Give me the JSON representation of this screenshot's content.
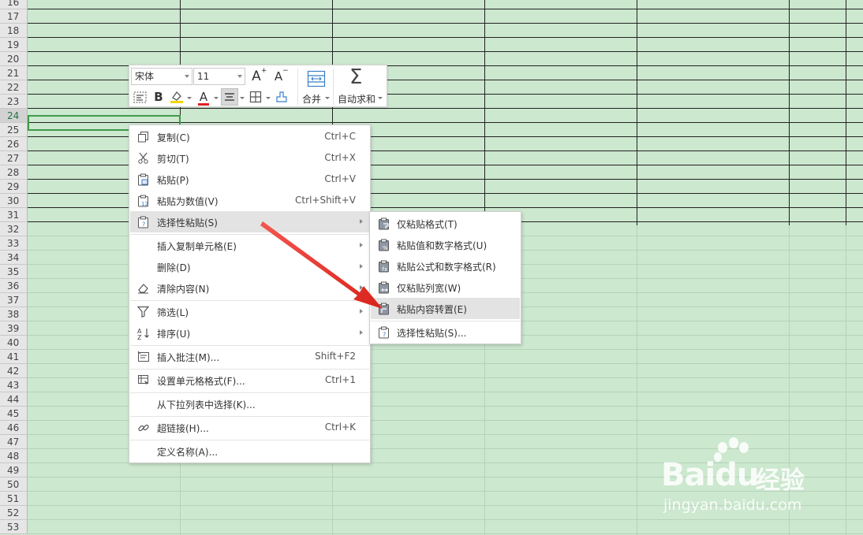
{
  "sheet": {
    "row_numbers": [
      "16",
      "17",
      "18",
      "19",
      "20",
      "21",
      "22",
      "23",
      "24",
      "25",
      "26",
      "27",
      "28",
      "29",
      "30",
      "31",
      "32",
      "33",
      "34",
      "35",
      "36",
      "37",
      "38",
      "39",
      "40",
      "41",
      "42",
      "43",
      "44",
      "45",
      "46",
      "47",
      "48",
      "49",
      "50",
      "51",
      "52",
      "53"
    ],
    "active_row": "24",
    "bordered_rows": [
      "16",
      "17",
      "18",
      "19",
      "20",
      "21",
      "22",
      "23",
      "24",
      "25",
      "26",
      "27",
      "28",
      "29",
      "30",
      "31"
    ]
  },
  "mini_toolbar": {
    "font_name": "宋体",
    "font_size": "11",
    "increase_font_icon": "font-increase-icon",
    "decrease_font_icon": "font-decrease-icon",
    "merge_label": "合并",
    "autosum_label": "自动求和",
    "bold_glyph": "B",
    "font_color_glyph": "A",
    "grow_glyph": "A",
    "shrink_glyph": "A"
  },
  "context_menu": {
    "items": [
      {
        "label": "复制(C)",
        "shortcut": "Ctrl+C",
        "icon": "copy-icon"
      },
      {
        "label": "剪切(T)",
        "shortcut": "Ctrl+X",
        "icon": "cut-icon"
      },
      {
        "label": "粘贴(P)",
        "shortcut": "Ctrl+V",
        "icon": "paste-icon"
      },
      {
        "label": "粘贴为数值(V)",
        "shortcut": "Ctrl+Shift+V",
        "icon": "paste-values-icon"
      },
      {
        "label": "选择性粘贴(S)",
        "shortcut": "",
        "icon": "paste-special-icon"
      },
      {
        "label": "插入复制单元格(E)",
        "shortcut": "",
        "icon": ""
      },
      {
        "label": "删除(D)",
        "shortcut": "",
        "icon": ""
      },
      {
        "label": "清除内容(N)",
        "shortcut": "",
        "icon": "eraser-icon"
      },
      {
        "label": "筛选(L)",
        "shortcut": "",
        "icon": "filter-icon"
      },
      {
        "label": "排序(U)",
        "shortcut": "",
        "icon": "sort-icon"
      },
      {
        "label": "插入批注(M)...",
        "shortcut": "Shift+F2",
        "icon": "comment-icon"
      },
      {
        "label": "设置单元格格式(F)...",
        "shortcut": "Ctrl+1",
        "icon": "format-cells-icon"
      },
      {
        "label": "从下拉列表中选择(K)...",
        "shortcut": "",
        "icon": ""
      },
      {
        "label": "超链接(H)...",
        "shortcut": "Ctrl+K",
        "icon": "hyperlink-icon"
      },
      {
        "label": "定义名称(A)...",
        "shortcut": "",
        "icon": ""
      }
    ]
  },
  "submenu": {
    "items": [
      {
        "label": "仅粘贴格式(T)",
        "icon": "paste-format-icon"
      },
      {
        "label": "粘贴值和数字格式(U)",
        "icon": "paste-values-number-icon"
      },
      {
        "label": "粘贴公式和数字格式(R)",
        "icon": "paste-formula-icon"
      },
      {
        "label": "仅粘贴列宽(W)",
        "icon": "paste-column-width-icon"
      },
      {
        "label": "粘贴内容转置(E)",
        "icon": "paste-transpose-icon"
      },
      {
        "label": "选择性粘贴(S)...",
        "icon": "paste-special-icon"
      }
    ]
  },
  "watermark": {
    "brand": "Bai",
    "brand_suffix": "du",
    "cn": "经验",
    "url": "jingyan.baidu.com"
  },
  "colors": {
    "sheet_bg": "#cce8cf",
    "selection": "#3f9a48",
    "arrow": "#e8302a"
  }
}
